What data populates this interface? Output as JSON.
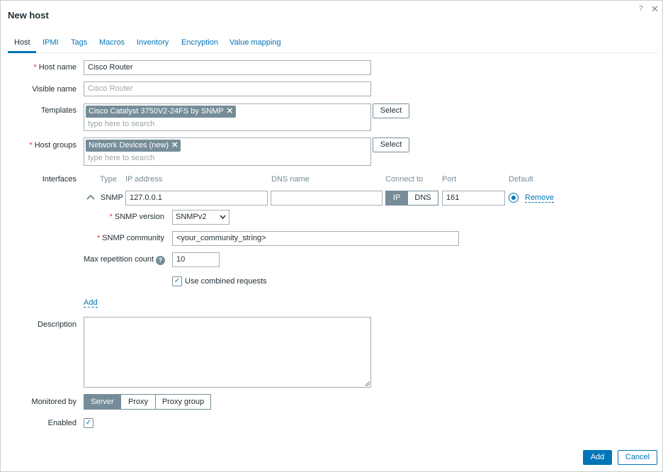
{
  "dialog": {
    "title": "New host",
    "help_icon": "?",
    "close_icon": "✕"
  },
  "tabs": [
    {
      "label": "Host",
      "active": true
    },
    {
      "label": "IPMI"
    },
    {
      "label": "Tags"
    },
    {
      "label": "Macros"
    },
    {
      "label": "Inventory"
    },
    {
      "label": "Encryption"
    },
    {
      "label": "Value mapping"
    }
  ],
  "form": {
    "host_name": {
      "label": "Host name",
      "value": "Cisco Router"
    },
    "visible_name": {
      "label": "Visible name",
      "placeholder": "Cisco Router"
    },
    "templates": {
      "label": "Templates",
      "chip": "Cisco Catalyst 3750V2-24FS by SNMP",
      "search_placeholder": "type here to search",
      "select_label": "Select"
    },
    "host_groups": {
      "label": "Host groups",
      "chip": "Network Devices (new)",
      "search_placeholder": "type here to search",
      "select_label": "Select"
    },
    "interfaces": {
      "label": "Interfaces",
      "headers": {
        "type": "Type",
        "ip": "IP address",
        "dns": "DNS name",
        "connect": "Connect to",
        "port": "Port",
        "default": "Default"
      },
      "row": {
        "type": "SNMP",
        "ip": "127.0.0.1",
        "dns": "",
        "connect_ip": "IP",
        "connect_dns": "DNS",
        "connect_selected": "IP",
        "port": "161",
        "remove_label": "Remove"
      },
      "snmp_version": {
        "label": "SNMP version",
        "value": "SNMPv2"
      },
      "snmp_community": {
        "label": "SNMP community",
        "value": "<your_community_string>"
      },
      "max_repetition": {
        "label": "Max repetition count",
        "value": "10",
        "help": "?"
      },
      "combined_requests": {
        "label": "Use combined requests",
        "checked": true
      },
      "add_label": "Add"
    },
    "description": {
      "label": "Description",
      "value": ""
    },
    "monitored_by": {
      "label": "Monitored by",
      "options": [
        "Server",
        "Proxy",
        "Proxy group"
      ],
      "selected": "Server"
    },
    "enabled": {
      "label": "Enabled",
      "checked": true
    }
  },
  "footer": {
    "add_label": "Add",
    "cancel_label": "Cancel"
  },
  "colors": {
    "accent": "#0275b8",
    "chip": "#768d99",
    "required": "#e33734"
  }
}
